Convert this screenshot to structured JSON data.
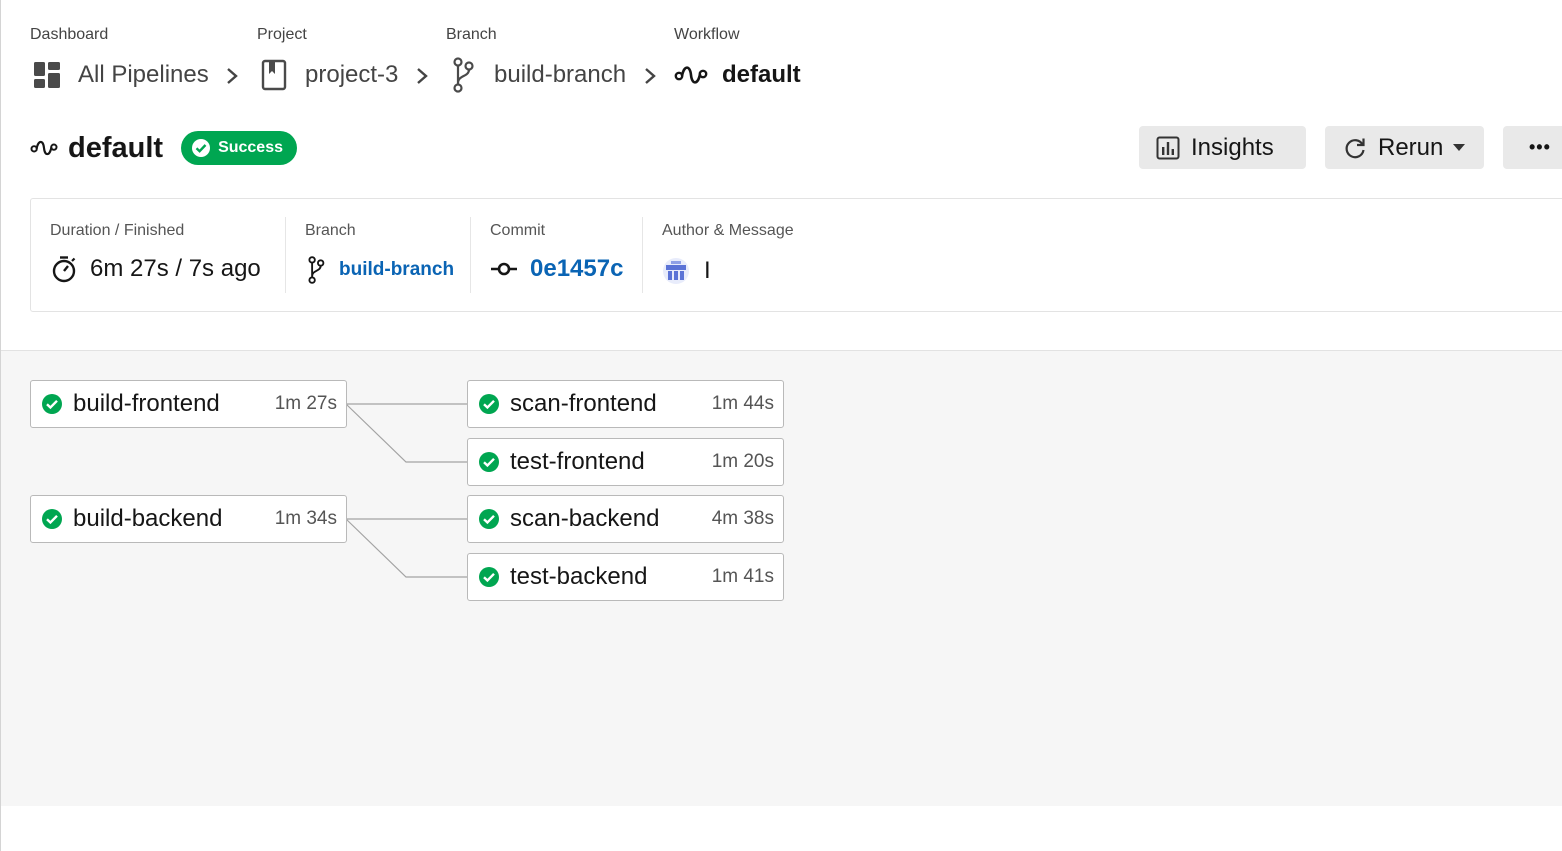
{
  "breadcrumb": [
    {
      "caption": "Dashboard",
      "label": "All Pipelines",
      "icon": "dashboard-icon"
    },
    {
      "caption": "Project",
      "label": "project-3",
      "icon": "project-icon"
    },
    {
      "caption": "Branch",
      "label": "build-branch",
      "icon": "branch-icon"
    },
    {
      "caption": "Workflow",
      "label": "default",
      "icon": "workflow-icon"
    }
  ],
  "workflow": {
    "title": "default",
    "status": "Success",
    "status_color": "#00a651"
  },
  "actions": {
    "insights_label": "Insights",
    "rerun_label": "Rerun",
    "more_label": "•••"
  },
  "meta": {
    "duration_label": "Duration / Finished",
    "duration_value": "6m 27s / 7s ago",
    "branch_label": "Branch",
    "branch_value": "build-branch",
    "commit_label": "Commit",
    "commit_value": "0e1457c",
    "author_label": "Author & Message",
    "author_message": "I"
  },
  "jobs": [
    {
      "name": "build-frontend",
      "duration": "1m 27s",
      "status": "success"
    },
    {
      "name": "scan-frontend",
      "duration": "1m 44s",
      "status": "success"
    },
    {
      "name": "test-frontend",
      "duration": "1m 20s",
      "status": "success"
    },
    {
      "name": "build-backend",
      "duration": "1m 34s",
      "status": "success"
    },
    {
      "name": "scan-backend",
      "duration": "4m 38s",
      "status": "success"
    },
    {
      "name": "test-backend",
      "duration": "1m 41s",
      "status": "success"
    }
  ],
  "colors": {
    "success": "#00a651",
    "link": "#0a64b4"
  }
}
